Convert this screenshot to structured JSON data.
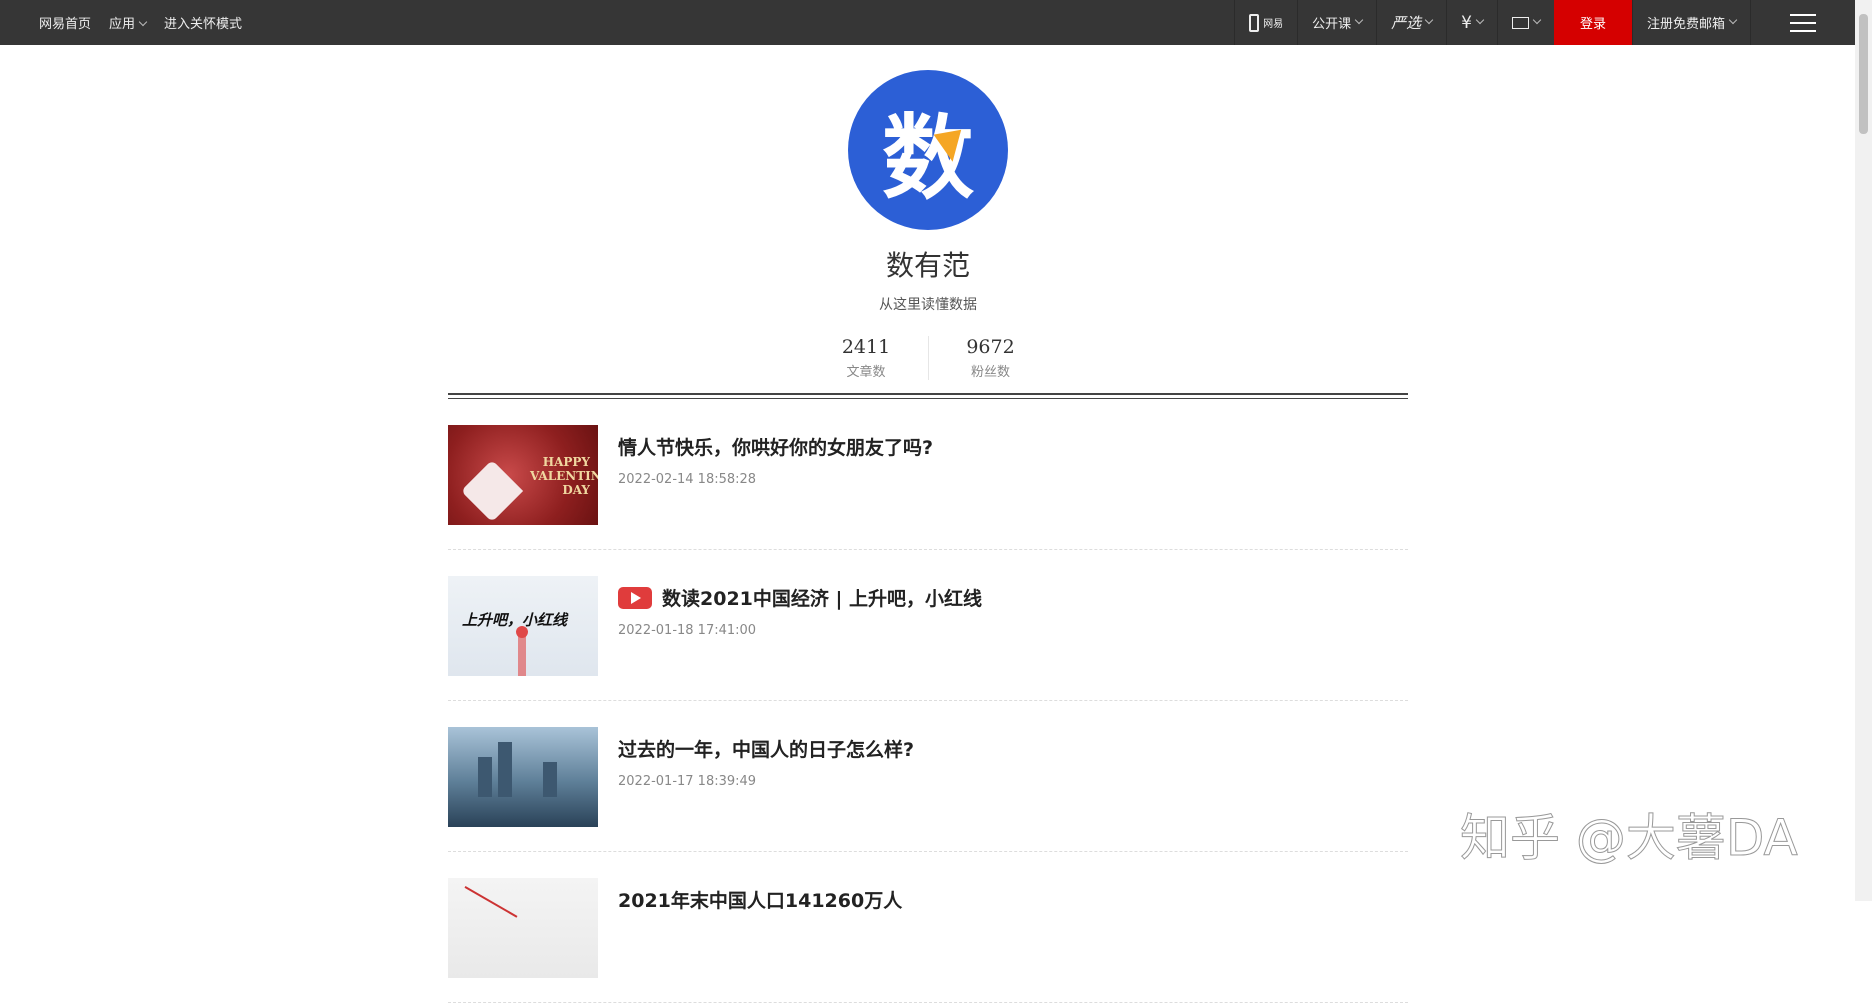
{
  "topbar": {
    "home": "网易首页",
    "apps": "应用",
    "care_mode": "进入关怀模式",
    "phone_label": "网易",
    "open_course": "公开课",
    "yanxuan": "严选",
    "login": "登录",
    "register_mail": "注册免费邮箱"
  },
  "profile": {
    "avatar_char": "数",
    "name": "数有范",
    "desc": "从这里读懂数据",
    "stats": [
      {
        "num": "2411",
        "label": "文章数"
      },
      {
        "num": "9672",
        "label": "粉丝数"
      }
    ]
  },
  "articles": [
    {
      "title": "情人节快乐，你哄好你的女朋友了吗?",
      "date": "2022-02-14 18:58:28",
      "thumb_text": "HAPPY VALENTINE'S DAY"
    },
    {
      "title": "数读2021中国经济 | 上升吧，小红线",
      "date": "2022-01-18 17:41:00",
      "thumb_text": "上升吧，小红线",
      "video": true
    },
    {
      "title": "过去的一年，中国人的日子怎么样?",
      "date": "2022-01-17 18:39:49"
    },
    {
      "title": "2021年末中国人口141260万人",
      "date": ""
    }
  ],
  "watermark": "知乎 @大薯DA",
  "colors": {
    "topbar": "#363636",
    "login": "#d50000",
    "avatar": "#2c5fd6",
    "video_icon": "#e03c3c"
  }
}
